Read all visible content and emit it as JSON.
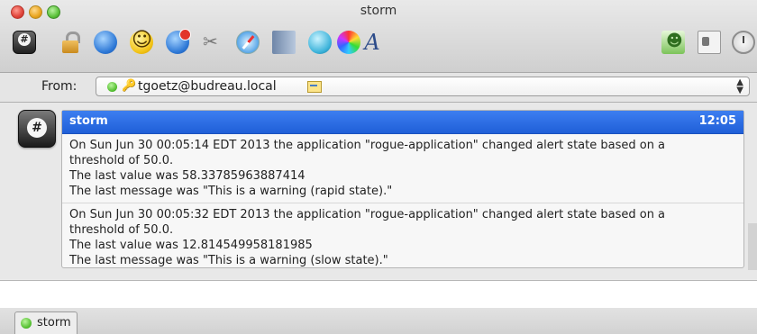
{
  "window": {
    "title": "storm"
  },
  "toolbar": {
    "icons": [
      "dial-icon",
      "lock-icon",
      "chat-bubble-icon",
      "smiley-icon",
      "block-icon",
      "plug-icon",
      "safari-icon",
      "address-book-icon",
      "blue-ball-icon",
      "color-wheel-icon",
      "font-icon",
      "contact-icon",
      "card-icon",
      "clock-icon"
    ]
  },
  "from_bar": {
    "label": "From:",
    "account": "tgoetz@budreau.local",
    "status_color": "#4cba28"
  },
  "message": {
    "sender": "storm",
    "time": "12:05",
    "header_color": "#2d6fe4",
    "entries": [
      {
        "line1": "On Sun Jun 30 00:05:14 EDT 2013 the application \"rogue-application\" changed alert state based on a",
        "line2": "threshold of 50.0.",
        "line3": "The last value was 58.33785963887414",
        "line4": "The last message was \"This is a warning (rapid state).\""
      },
      {
        "line1": "On Sun Jun 30 00:05:32 EDT 2013 the application \"rogue-application\" changed alert state based on a",
        "line2": "threshold of 50.0.",
        "line3": "The last value was 12.814549958181985",
        "line4": "The last message was \"This is a warning (slow state).\""
      }
    ]
  },
  "tabs": [
    {
      "label": "storm"
    }
  ]
}
